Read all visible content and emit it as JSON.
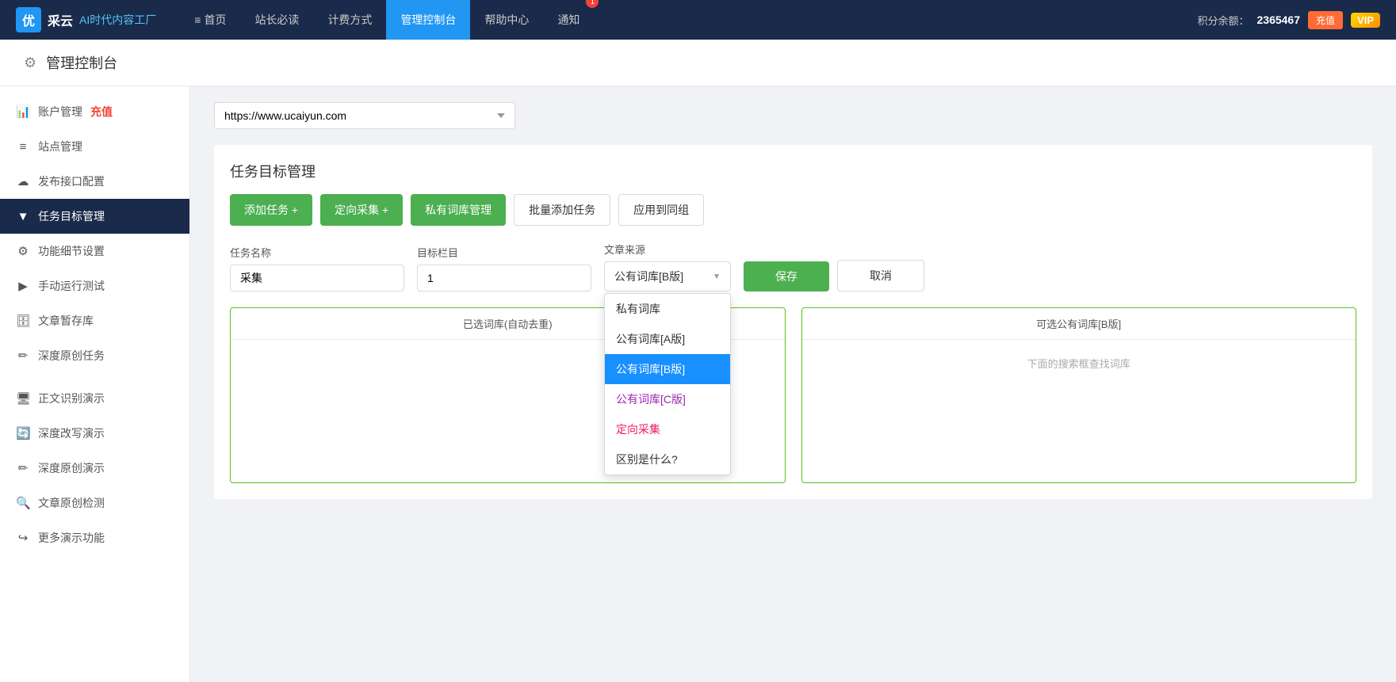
{
  "app": {
    "logo_icon": "优",
    "logo_subtitle": "AI时代内容工厂",
    "vip_badge": "VIP"
  },
  "topnav": {
    "items": [
      {
        "id": "home",
        "label": "首页",
        "icon": "≡",
        "active": false
      },
      {
        "id": "webmaster",
        "label": "站长必读",
        "icon": "",
        "active": false
      },
      {
        "id": "pricing",
        "label": "计费方式",
        "icon": "",
        "active": false
      },
      {
        "id": "dashboard",
        "label": "管理控制台",
        "icon": "",
        "active": true
      },
      {
        "id": "help",
        "label": "帮助中心",
        "icon": "",
        "active": false
      },
      {
        "id": "notification",
        "label": "通知",
        "icon": "",
        "active": false
      }
    ],
    "notification_count": "1",
    "points_label": "积分余额：",
    "points_value": "2365467",
    "recharge_label": "充值"
  },
  "page_header": {
    "title": "管理控制台",
    "icon": "⚙"
  },
  "sidebar": {
    "items": [
      {
        "id": "account",
        "label": "账户管理",
        "icon": "📊",
        "has_recharge": true,
        "recharge_text": "充值",
        "active": false
      },
      {
        "id": "site",
        "label": "站点管理",
        "icon": "≡",
        "active": false
      },
      {
        "id": "publish",
        "label": "发布接口配置",
        "icon": "☁",
        "active": false
      },
      {
        "id": "task",
        "label": "任务目标管理",
        "icon": "▼",
        "active": true
      },
      {
        "id": "settings",
        "label": "功能细节设置",
        "icon": "⚙",
        "active": false
      },
      {
        "id": "manual",
        "label": "手动运行测试",
        "icon": "▶",
        "active": false
      },
      {
        "id": "draft",
        "label": "文章暂存库",
        "icon": "🗄",
        "active": false
      },
      {
        "id": "original",
        "label": "深度原创任务",
        "icon": "✏",
        "active": false
      },
      {
        "id": "ocr",
        "label": "正文识别演示",
        "icon": "🖥",
        "active": false
      },
      {
        "id": "rewrite",
        "label": "深度改写演示",
        "icon": "🔄",
        "active": false
      },
      {
        "id": "original_demo",
        "label": "深度原创演示",
        "icon": "✏",
        "active": false
      },
      {
        "id": "check",
        "label": "文章原创检测",
        "icon": "🔍",
        "active": false
      },
      {
        "id": "more",
        "label": "更多演示功能",
        "icon": "↪",
        "active": false
      }
    ]
  },
  "main": {
    "site_url": "https://www.ucaiyun.com",
    "section_title": "任务目标管理",
    "buttons": {
      "add_task": "添加任务 +",
      "directed_collect": "定向采集 +",
      "private_library": "私有词库管理",
      "batch_add": "批量添加任务",
      "apply_group": "应用到同组"
    },
    "form": {
      "task_name_label": "任务名称",
      "task_name_value": "采集",
      "target_col_label": "目标栏目",
      "target_col_value": "1",
      "source_label": "文章来源",
      "source_selected": "公有词库[B版]",
      "save_label": "保存",
      "cancel_label": "取消"
    },
    "dropdown": {
      "items": [
        {
          "id": "private",
          "label": "私有词库",
          "active": false,
          "color": "default"
        },
        {
          "id": "public_a",
          "label": "公有词库[A版]",
          "active": false,
          "color": "default"
        },
        {
          "id": "public_b",
          "label": "公有词库[B版]",
          "active": true,
          "color": "default"
        },
        {
          "id": "public_c",
          "label": "公有词库[C版]",
          "active": false,
          "color": "purple"
        },
        {
          "id": "directed",
          "label": "定向采集",
          "active": false,
          "color": "pink"
        },
        {
          "id": "diff",
          "label": "区别是什么?",
          "active": false,
          "color": "default"
        }
      ]
    },
    "panels": {
      "left_header": "已选词库(自动去重)",
      "right_header": "可选公有词库[B版]",
      "right_hint": "下面的搜索框查找词库"
    }
  }
}
